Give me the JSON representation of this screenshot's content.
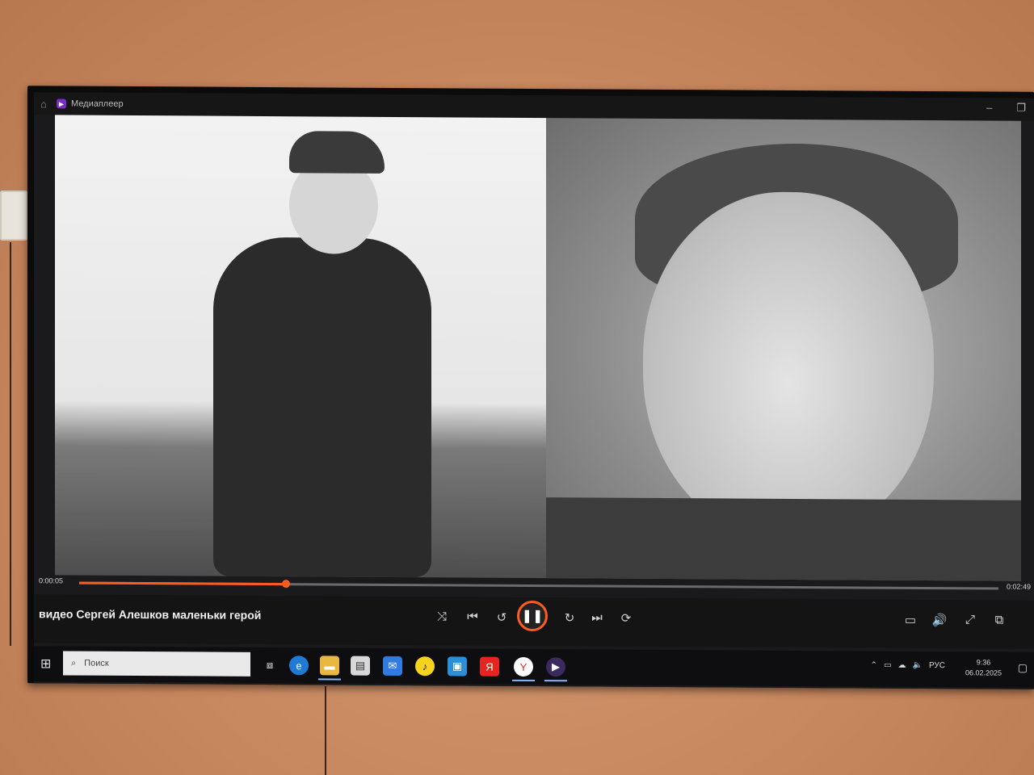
{
  "window": {
    "app_title": "Медиаплеер"
  },
  "player": {
    "video_title": "видео Сергей Алешков маленьки герой",
    "elapsed": "0:00:05",
    "duration": "0:02:49",
    "progress": 0.225
  },
  "taskbar": {
    "search_placeholder": "Поиск",
    "language": "РУС",
    "time": "9:36",
    "date": "06.02.2025",
    "icons": [
      "task-view-icon",
      "edge-icon",
      "explorer-icon",
      "notes-icon",
      "mail-icon",
      "yandex-music-icon",
      "store-icon",
      "yandex-icon",
      "yandex-browser-icon",
      "media-player-icon"
    ]
  },
  "colors": {
    "accent": "#ff5a1f",
    "taskbar": "#0e0e10",
    "wall": "#c98d68"
  }
}
